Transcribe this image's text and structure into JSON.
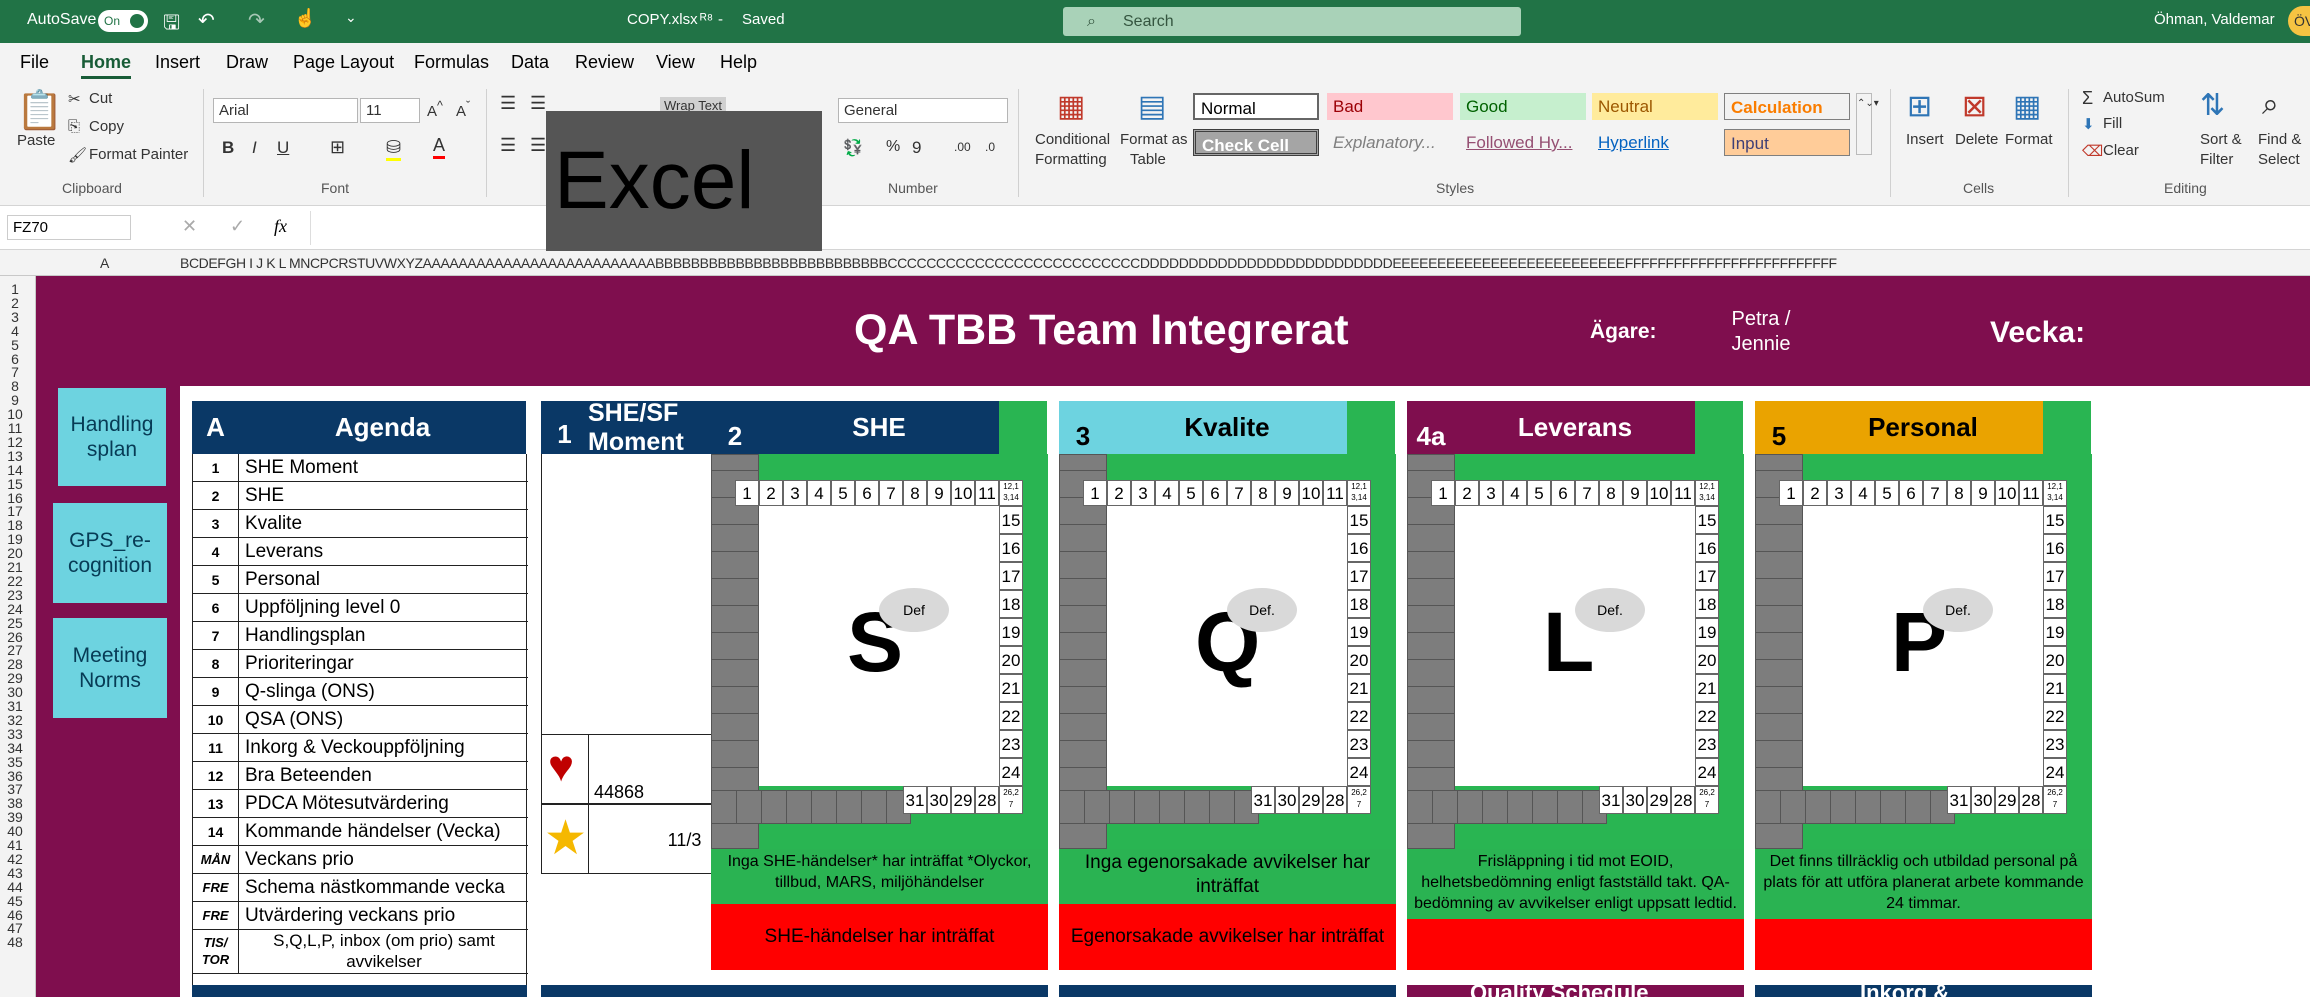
{
  "titlebar": {
    "autosave": "AutoSave",
    "toggle": "On",
    "filename": "COPY.xlsx",
    "saved": "Saved",
    "search": "Search",
    "user": "Öhman, Valdemar",
    "avatar": "ÖV"
  },
  "tabs": [
    "File",
    "Home",
    "Insert",
    "Draw",
    "Page Layout",
    "Formulas",
    "Data",
    "Review",
    "View",
    "Help"
  ],
  "ribbon": {
    "paste": "Paste",
    "cut": "Cut",
    "copy": "Copy",
    "format_painter": "Format Painter",
    "clipboard": "Clipboard",
    "font_name": "Arial",
    "font_size": "11",
    "font": "Font",
    "wrap": "Wrap Text",
    "number_format": "General",
    "number": "Number",
    "cond": "Conditional",
    "formatting": "Formatting",
    "format_as": "Format as",
    "table": "Table",
    "styles": "Styles",
    "cells": "Cells",
    "insert": "Insert",
    "delete": "Delete",
    "format": "Format",
    "autosum": "AutoSum",
    "fill": "Fill",
    "clear": "Clear",
    "sort": "Sort &",
    "filter": "Filter",
    "find": "Find &",
    "select": "Select",
    "editing": "Editing",
    "styles_list": [
      {
        "label": "Normal",
        "bg": "#ffffff",
        "fg": "#000000"
      },
      {
        "label": "Bad",
        "bg": "#ffc7ce",
        "fg": "#9c0006"
      },
      {
        "label": "Good",
        "bg": "#c6efce",
        "fg": "#006100"
      },
      {
        "label": "Neutral",
        "bg": "#ffeb9c",
        "fg": "#9c5700"
      },
      {
        "label": "Calculation",
        "bg": "#f2f2f2",
        "fg": "#fa7d00"
      },
      {
        "label": "Check Cell",
        "bg": "#a5a5a5",
        "fg": "#ffffff"
      },
      {
        "label": "Explanatory...",
        "bg": "#f3f3f3",
        "fg": "#7f7f7f"
      },
      {
        "label": "Followed Hy...",
        "bg": "#f3f3f3",
        "fg": "#954f72"
      },
      {
        "label": "Hyperlink",
        "bg": "#f3f3f3",
        "fg": "#0563c1"
      },
      {
        "label": "Input",
        "bg": "#ffcc99",
        "fg": "#3f3f76"
      }
    ]
  },
  "overlay": "Excel",
  "formula": {
    "namebox": "FZ70",
    "fx": "fx"
  },
  "colhdr": "A",
  "colhdr_rest": "BCDEFGH I J K L MNCPCRSTUVWXYZAAAAAAAAAAAAAAAAAAAAAAAAAABBBBBBBBBBBBBBBBBBBBBBBBBBCCCCCCCCCCCCCCCCCCCCCCCCCCDDDDDDDDDDDDDDDDDDDDDDDDDDEEEEEEEEEEEEEEEEEEEEEEEEEEFFFFFFFFFFFFFFFFFFFFFFFFFF",
  "rows": [
    "1",
    "2",
    "3",
    "4",
    "5",
    "6",
    "7",
    "8",
    "9",
    "10",
    "11",
    "12",
    "13",
    "14",
    "15",
    "16",
    "17",
    "18",
    "19",
    "20",
    "21",
    "22",
    "23",
    "24",
    "25",
    "26",
    "27",
    "28",
    "29",
    "30",
    "31",
    "32",
    "33",
    "34",
    "35",
    "36",
    "37",
    "38",
    "39",
    "40",
    "41",
    "42",
    "43",
    "44",
    "45",
    "46",
    "47",
    "48"
  ],
  "sheet": {
    "title": "QA TBB Team Integrerat",
    "owner_label": "Ägare:",
    "owner": "Petra / Jennie",
    "week_label": "Vecka:",
    "buttons": [
      "Handling splan",
      "GPS_re-cognition",
      "Meeting Norms"
    ],
    "agenda_head_letter": "A",
    "agenda_head": "Agenda",
    "agenda": [
      {
        "n": "1",
        "t": "SHE Moment"
      },
      {
        "n": "2",
        "t": "SHE"
      },
      {
        "n": "3",
        "t": "Kvalite"
      },
      {
        "n": "4",
        "t": "Leverans"
      },
      {
        "n": "5",
        "t": "Personal"
      },
      {
        "n": "6",
        "t": "Uppföljning level 0"
      },
      {
        "n": "7",
        "t": "Handlingsplan"
      },
      {
        "n": "8",
        "t": "Prioriteringar"
      },
      {
        "n": "9",
        "t": "Q-slinga (ONS)"
      },
      {
        "n": "10",
        "t": "QSA (ONS)"
      },
      {
        "n": "11",
        "t": "Inkorg & Veckouppföljning"
      },
      {
        "n": "12",
        "t": "Bra Beteenden"
      },
      {
        "n": "13",
        "t": "PDCA Mötesutvärdering"
      },
      {
        "n": "14",
        "t": "Kommande händelser (Vecka)"
      },
      {
        "n": "MÅN",
        "t": "Veckans prio"
      },
      {
        "n": "FRE",
        "t": "Schema nästkommande vecka"
      },
      {
        "n": "FRE",
        "t": "Utvärdering veckans prio"
      },
      {
        "n": "TIS/ TOR",
        "t": "S,Q,L,P, inbox (om prio) samt avvikelser"
      }
    ],
    "she_moment_num": "1",
    "she_moment": "SHE/SF Moment",
    "heart_value": "44868",
    "star_value": "11/3",
    "panels": [
      {
        "num": "2",
        "title": "SHE",
        "letter": "S",
        "def": "Def",
        "color": "#0a3866",
        "tcolor": "#ffffff",
        "green": "Inga SHE-händelser* har inträffat *Olyckor, tillbud, MARS, miljöhändelser",
        "red": "SHE-händelser har inträffat"
      },
      {
        "num": "3",
        "title": "Kvalite",
        "letter": "Q",
        "def": "Def.",
        "color": "#6dd3e0",
        "tcolor": "#000000",
        "green": "Inga egenorsakade avvikelser har inträffat",
        "red": "Egenorsakade avvikelser har inträffat"
      },
      {
        "num": "4a",
        "title": "Leverans",
        "letter": "L",
        "def": "Def.",
        "color": "#7f0e4e",
        "tcolor": "#ffffff",
        "green": "Frisläppning i tid mot EOID, helhetsbedömning enligt fastställd takt. QA-bedömning av avvikelser enligt uppsatt ledtid.",
        "red": ""
      },
      {
        "num": "5",
        "title": "Personal",
        "letter": "P",
        "def": "Def.",
        "color": "#eaa300",
        "tcolor": "#000000",
        "green": "Det finns tillräcklig och utbildad personal på plats för att utföra planerat arbete kommande 24 timmar.",
        "red": ""
      }
    ],
    "top_nums": [
      "1",
      "2",
      "3",
      "4",
      "5",
      "6",
      "7",
      "8",
      "9",
      "10",
      "11"
    ],
    "corner_tr": "12,1 3,14",
    "right_nums": [
      "15",
      "16",
      "17",
      "18",
      "19",
      "20",
      "21",
      "22",
      "23",
      "24"
    ],
    "bottom_nums": [
      "31",
      "30",
      "29",
      "28"
    ],
    "corner_br": "26,2 7",
    "bottom_peek": [
      "Quality Schedule",
      "Inkorg &"
    ]
  }
}
